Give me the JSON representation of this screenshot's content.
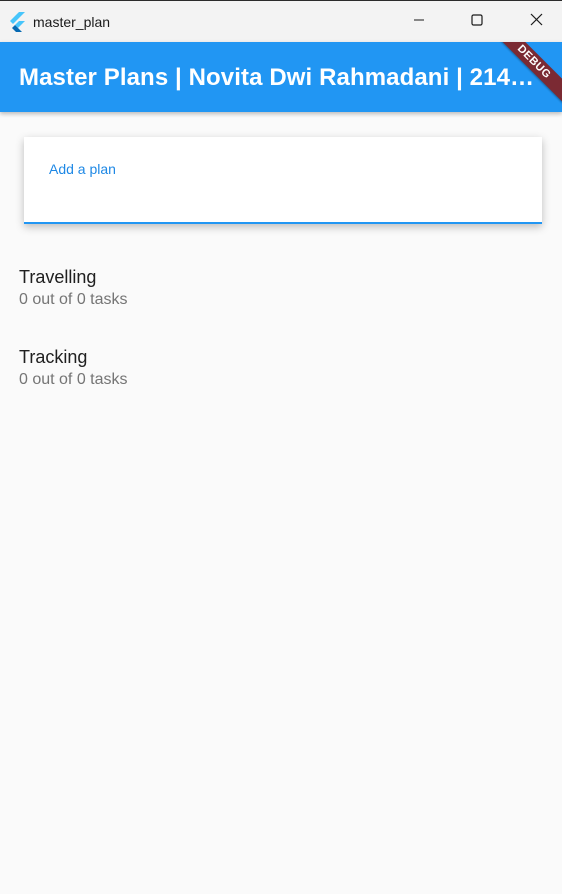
{
  "window": {
    "title": "master_plan"
  },
  "appbar": {
    "title": "Master Plans | Novita Dwi Rahmadani | 2141...",
    "debug_label": "DEBUG"
  },
  "input": {
    "label": "Add a plan"
  },
  "plans": [
    {
      "title": "Travelling",
      "subtitle": "0 out of 0 tasks"
    },
    {
      "title": "Tracking",
      "subtitle": "0 out of 0 tasks"
    }
  ],
  "colors": {
    "primary": "#2196f3",
    "debug_banner": "#7b2a33",
    "background": "#fafafa"
  },
  "icons": {
    "app": "flutter-icon",
    "minimize": "minimize-icon",
    "maximize": "maximize-icon",
    "close": "close-icon"
  }
}
